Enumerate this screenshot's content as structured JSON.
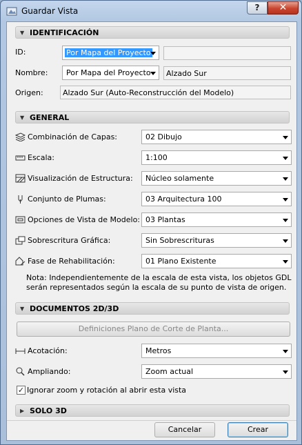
{
  "window": {
    "title": "Guardar Vista",
    "help_label": "?",
    "close_label": "✕"
  },
  "sections": {
    "identificacion": "IDENTIFICACIÓN",
    "general": "GENERAL",
    "documentos": "DOCUMENTOS 2D/3D",
    "solo3d": "SOLO 3D"
  },
  "ident": {
    "id_label": "ID:",
    "id_select": "Por Mapa del Proyecto",
    "id_text": "",
    "nombre_label": "Nombre:",
    "nombre_select": "Por Mapa del Proyecto",
    "nombre_text": "Alzado Sur",
    "origen_label": "Origen:",
    "origen_text": "Alzado Sur (Auto-Reconstrucción del Modelo)"
  },
  "general": {
    "rows": [
      {
        "label": "Combinación de Capas:",
        "value": "02 Dibujo",
        "icon": "layers-icon"
      },
      {
        "label": "Escala:",
        "value": "1:100",
        "icon": "scale-ruler-icon"
      },
      {
        "label": "Visualización de Estructura:",
        "value": "Núcleo solamente",
        "icon": "structure-icon"
      },
      {
        "label": "Conjunto de Plumas:",
        "value": "03 Arquitectura 100",
        "icon": "pen-icon"
      },
      {
        "label": "Opciones de Vista de Modelo:",
        "value": "03 Plantas",
        "icon": "model-view-icon"
      },
      {
        "label": "Sobrescritura Gráfica:",
        "value": "Sin Sobrescrituras",
        "icon": "graphic-override-icon"
      },
      {
        "label": "Fase de Rehabilitación:",
        "value": "01 Plano Existente",
        "icon": "renovation-icon"
      }
    ],
    "note": "Nota: Independientemente de la escala de esta vista, los objetos GDL serán representados según la escala de su punto de vista de origen."
  },
  "documentos": {
    "cut_plane_button": "Definiciones Plano de Corte de Planta...",
    "acotacion_label": "Acotación:",
    "acotacion_value": "Metros",
    "ampliando_label": "Ampliando:",
    "ampliando_value": "Zoom actual",
    "ignore_zoom_label": "Ignorar zoom y rotación al abrir esta vista",
    "ignore_zoom_checked": true
  },
  "footer": {
    "cancel_label": "Cancelar",
    "create_label": "Crear"
  },
  "colors": {
    "selection": "#3399ff",
    "title_bar": "#b9cfe8",
    "close_button": "#c9442e"
  }
}
